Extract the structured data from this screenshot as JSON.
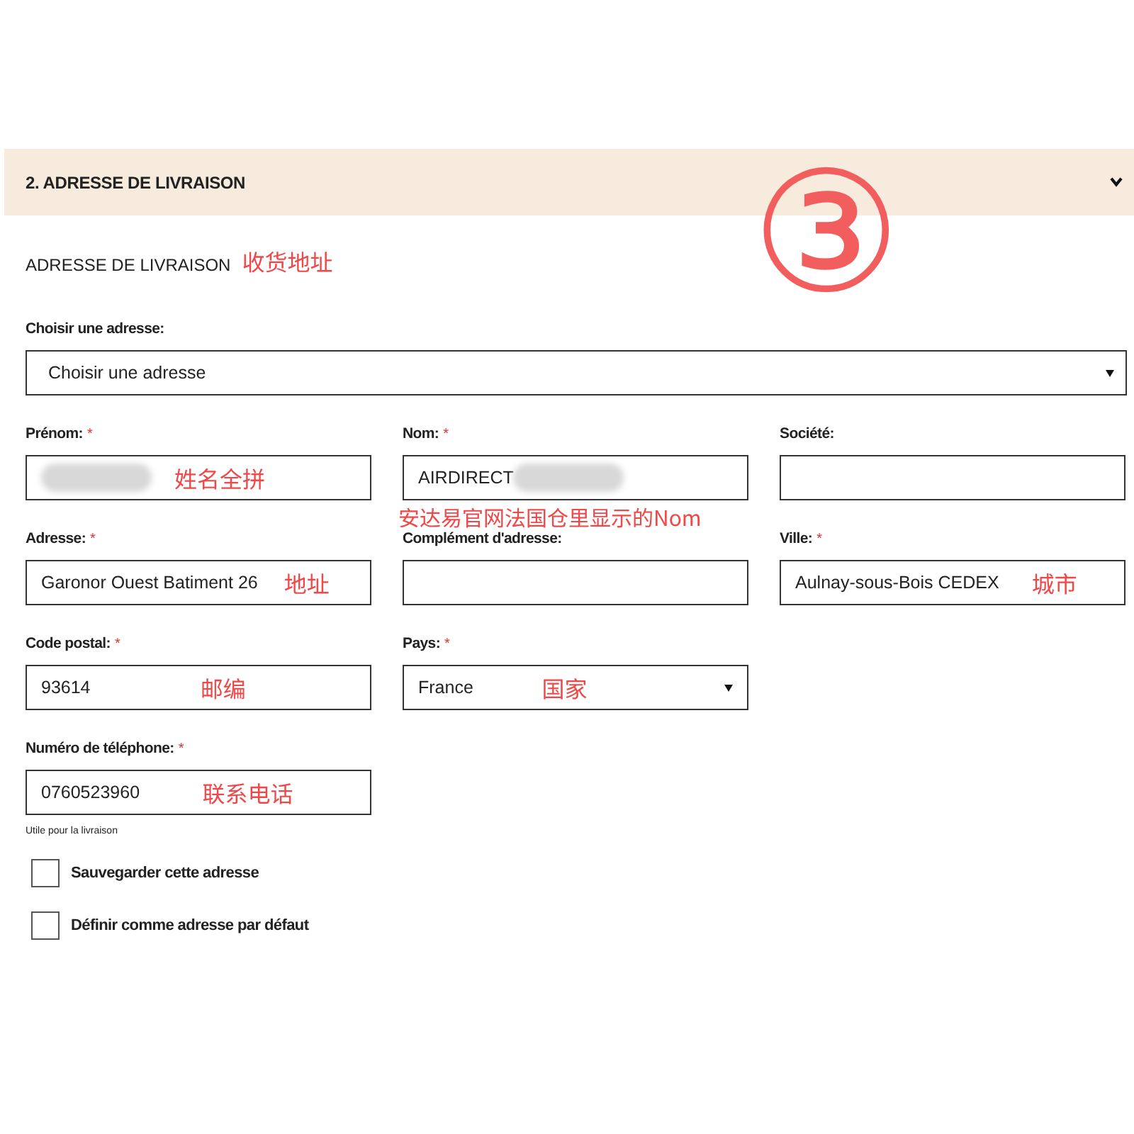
{
  "section": {
    "title": "2. ADRESSE DE LIVRAISON",
    "expanded": true
  },
  "step_marker": "③",
  "heading": {
    "text": "ADRESSE DE LIVRAISON",
    "note": "收货地址"
  },
  "required_mark": "*",
  "address_select": {
    "label": "Choisir une adresse:",
    "value": "Choisir une adresse"
  },
  "rows": [
    [
      {
        "kind": "text",
        "label": "Prénom:",
        "required": true,
        "redacted": true,
        "note": "姓名全拼"
      },
      {
        "kind": "text",
        "label": "Nom:",
        "required": true,
        "value": "AIRDIRECT",
        "redacted": true,
        "below_note": "安达易官网法国仓里显示的Nom"
      },
      {
        "kind": "text",
        "label": "Société:",
        "required": false
      }
    ],
    [
      {
        "kind": "text",
        "label": "Adresse:",
        "required": true,
        "value": "Garonor Ouest Batiment 26",
        "note": "地址"
      },
      {
        "kind": "text",
        "label": "Complément d'adresse:",
        "required": false
      },
      {
        "kind": "text",
        "label": "Ville:",
        "required": true,
        "value": "Aulnay-sous-Bois CEDEX",
        "note": "城市"
      }
    ],
    [
      {
        "kind": "text",
        "label": "Code postal:",
        "required": true,
        "value": "93614",
        "note": "邮编"
      },
      {
        "kind": "select",
        "label": "Pays:",
        "required": true,
        "value": "France",
        "note": "国家"
      }
    ],
    [
      {
        "kind": "text",
        "label": "Numéro de téléphone:",
        "required": true,
        "value": "0760523960",
        "note": "联系电话",
        "helper": "Utile pour la livraison"
      }
    ]
  ],
  "checkboxes": [
    {
      "label": "Sauvegarder cette adresse",
      "checked": false
    },
    {
      "label": "Définir comme adresse par défaut",
      "checked": false
    }
  ]
}
